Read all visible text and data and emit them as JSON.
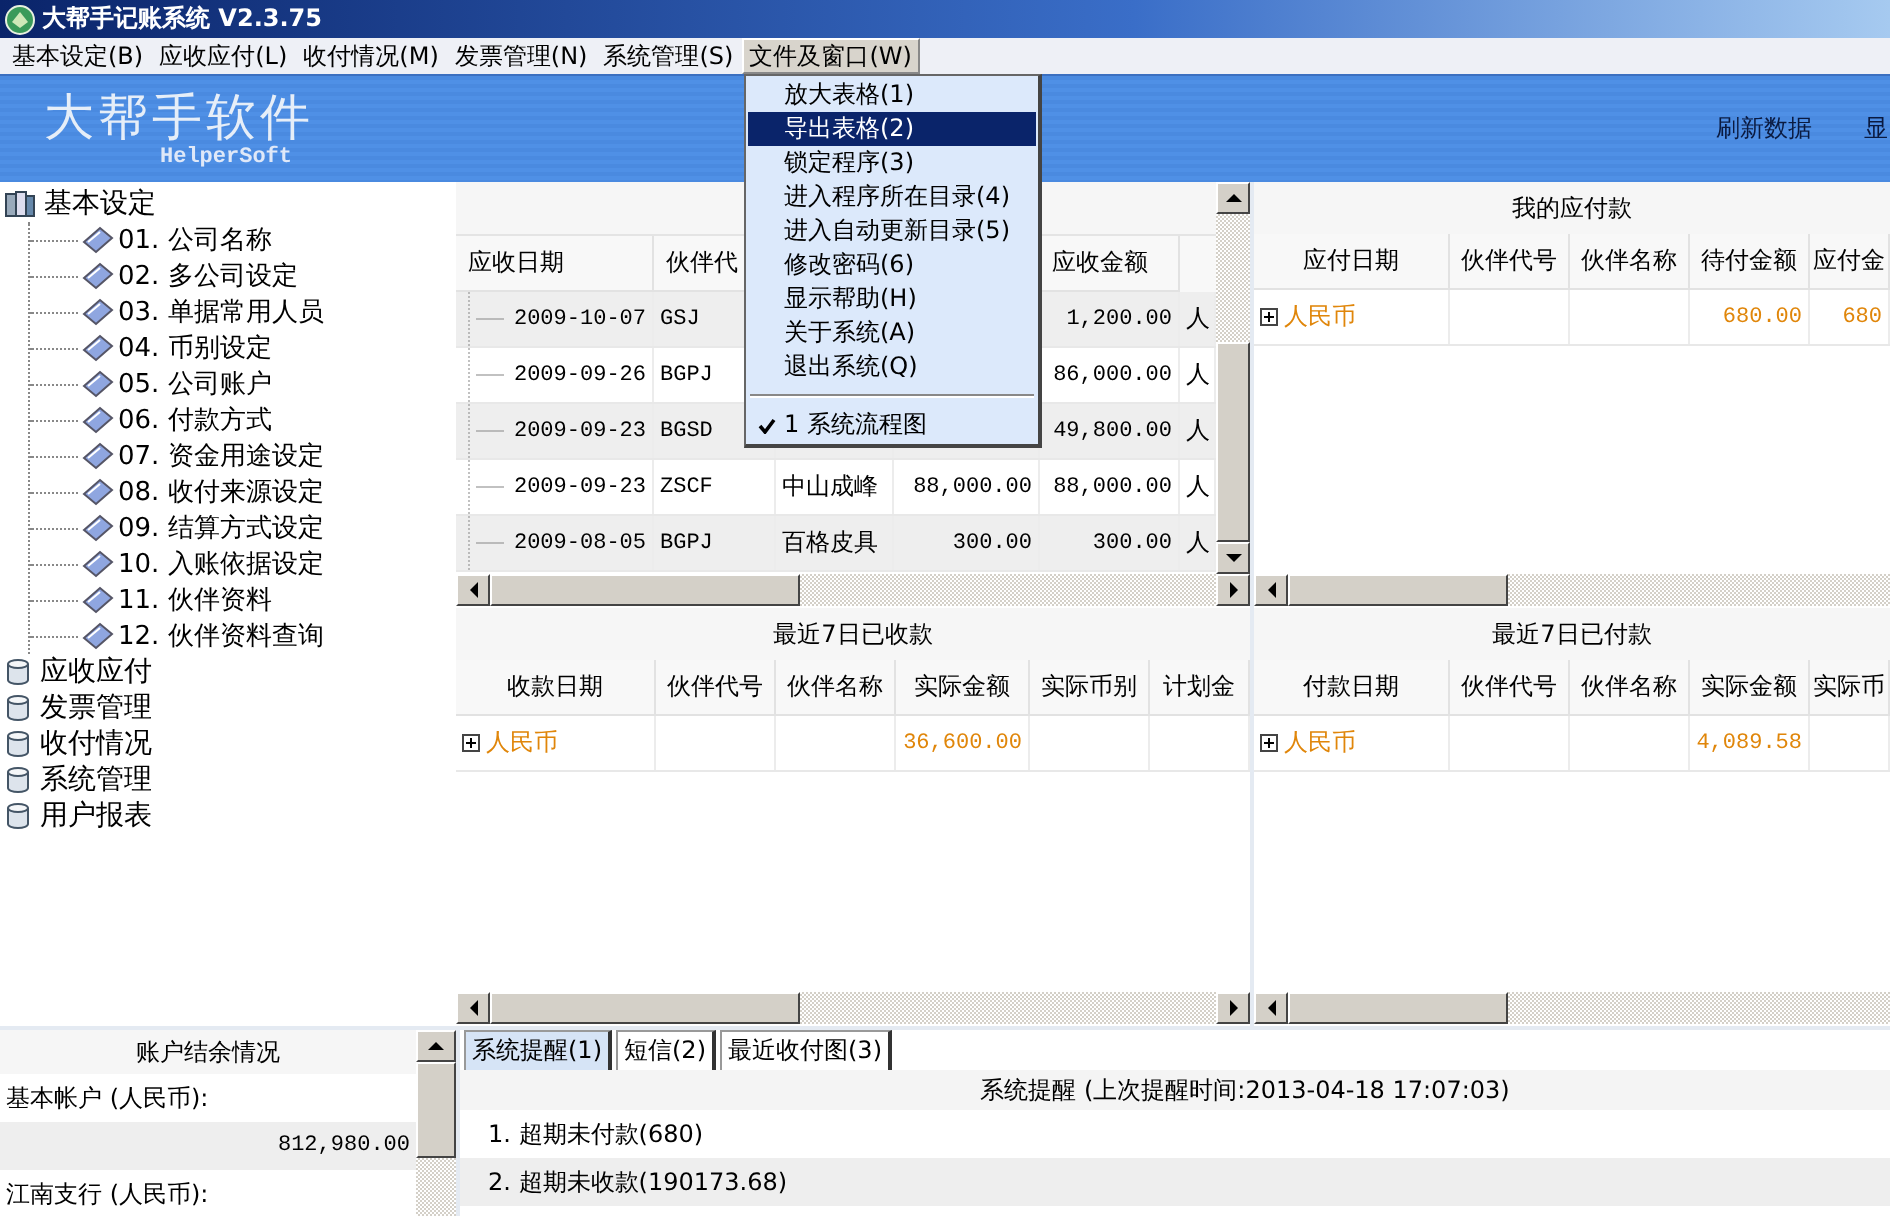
{
  "window": {
    "title": "大帮手记账系统 V2.3.75"
  },
  "menu_bar": [
    {
      "label": "基本设定(B)",
      "selected": false
    },
    {
      "label": "应收应付(L)",
      "selected": false
    },
    {
      "label": "收付情况(M)",
      "selected": false
    },
    {
      "label": "发票管理(N)",
      "selected": false
    },
    {
      "label": "系统管理(S)",
      "selected": false
    },
    {
      "label": "文件及窗口(W)",
      "selected": true
    }
  ],
  "dropdown_menu": [
    {
      "kind": "item",
      "label": "放大表格(1)",
      "selected": false,
      "checked": false
    },
    {
      "kind": "item",
      "label": "导出表格(2)",
      "selected": true,
      "checked": false
    },
    {
      "kind": "item",
      "label": "锁定程序(3)",
      "selected": false,
      "checked": false
    },
    {
      "kind": "item",
      "label": "进入程序所在目录(4)",
      "selected": false,
      "checked": false
    },
    {
      "kind": "item",
      "label": "进入自动更新目录(5)",
      "selected": false,
      "checked": false
    },
    {
      "kind": "item",
      "label": "修改密码(6)",
      "selected": false,
      "checked": false
    },
    {
      "kind": "item",
      "label": "显示帮助(H)",
      "selected": false,
      "checked": false
    },
    {
      "kind": "item",
      "label": "关于系统(A)",
      "selected": false,
      "checked": false
    },
    {
      "kind": "item",
      "label": "退出系统(Q)",
      "selected": false,
      "checked": false
    },
    {
      "kind": "separator"
    },
    {
      "kind": "item",
      "label": "1 系统流程图",
      "selected": false,
      "checked": true
    }
  ],
  "banner": {
    "logo": "大帮手软件",
    "logo_subtitle": "HelperSoft",
    "actions": [
      "刷新数据",
      "显"
    ]
  },
  "tree": [
    {
      "label": "基本设定",
      "expanded": true,
      "children": [
        {
          "label": "01. 公司名称"
        },
        {
          "label": "02. 多公司设定"
        },
        {
          "label": "03. 单据常用人员"
        },
        {
          "label": "04. 币别设定"
        },
        {
          "label": "05. 公司账户"
        },
        {
          "label": "06. 付款方式"
        },
        {
          "label": "07. 资金用途设定"
        },
        {
          "label": "08. 收付来源设定"
        },
        {
          "label": "09. 结算方式设定"
        },
        {
          "label": "10. 入账依据设定"
        },
        {
          "label": "11. 伙伴资料"
        },
        {
          "label": "12. 伙伴资料查询"
        }
      ]
    },
    {
      "label": "应收应付",
      "expanded": false
    },
    {
      "label": "发票管理",
      "expanded": false
    },
    {
      "label": "收付情况",
      "expanded": false
    },
    {
      "label": "系统管理",
      "expanded": false
    },
    {
      "label": "用户报表",
      "expanded": false
    }
  ],
  "receivables": {
    "headers": {
      "date": "应收日期",
      "code": "伙伴代",
      "amount": "应收金额"
    },
    "rows": [
      {
        "date": "2009-10-07",
        "code": "GSJ",
        "amount": "1,200.00",
        "currency": "人"
      },
      {
        "date": "2009-09-26",
        "code": "BGPJ",
        "amount": "86,000.00",
        "currency": "人"
      },
      {
        "date": "2009-09-23",
        "code": "BGSD",
        "amount": "49,800.00",
        "currency": "人"
      },
      {
        "date": "2009-09-23",
        "code": "ZSCF",
        "name": "中山成峰",
        "column_4": "88,000.00",
        "amount": "88,000.00",
        "currency": "人"
      },
      {
        "date": "2009-08-05",
        "code": "BGPJ",
        "name": "百格皮具",
        "column_4": "300.00",
        "amount": "300.00",
        "currency": "人"
      }
    ]
  },
  "payables": {
    "title": "我的应付款",
    "headers": {
      "date": "应付日期",
      "code": "伙伴代号",
      "name": "伙伴名称",
      "pending": "待付金额",
      "amount": "应付金"
    },
    "rows": [
      {
        "group": "人民币",
        "expanded": false,
        "pending": "680.00",
        "amount": "680"
      }
    ]
  },
  "received_7_days": {
    "title": "最近7日已收款",
    "headers": {
      "date": "收款日期",
      "code": "伙伴代号",
      "name": "伙伴名称",
      "actual": "实际金额",
      "currency": "实际币别",
      "planned": "计划金"
    },
    "rows": [
      {
        "group": "人民币",
        "expanded": false,
        "actual": "36,600.00"
      }
    ]
  },
  "paid_7_days": {
    "title": "最近7日已付款",
    "headers": {
      "date": "付款日期",
      "code": "伙伴代号",
      "name": "伙伴名称",
      "actual": "实际金额",
      "currency": "实际币"
    },
    "rows": [
      {
        "group": "人民币",
        "expanded": false,
        "actual": "4,089.58"
      }
    ]
  },
  "balance_panel": {
    "title": "账户结余情况",
    "rows": [
      {
        "kind": "label",
        "text": "基本帐户 (人民币):"
      },
      {
        "kind": "amount",
        "text": "812,980.00"
      },
      {
        "kind": "label",
        "text": "江南支行 (人民币):"
      }
    ]
  },
  "tabs": [
    {
      "label": "系统提醒(1)",
      "selected": true
    },
    {
      "label": "短信(2)",
      "selected": false
    },
    {
      "label": "最近收付图(3)",
      "selected": false
    }
  ],
  "reminders": {
    "header": "系统提醒 (上次提醒时间:2013-04-18 17:07:03)",
    "items": [
      "1. 超期未付款(680)",
      "2. 超期未收款(190173.68)"
    ]
  }
}
